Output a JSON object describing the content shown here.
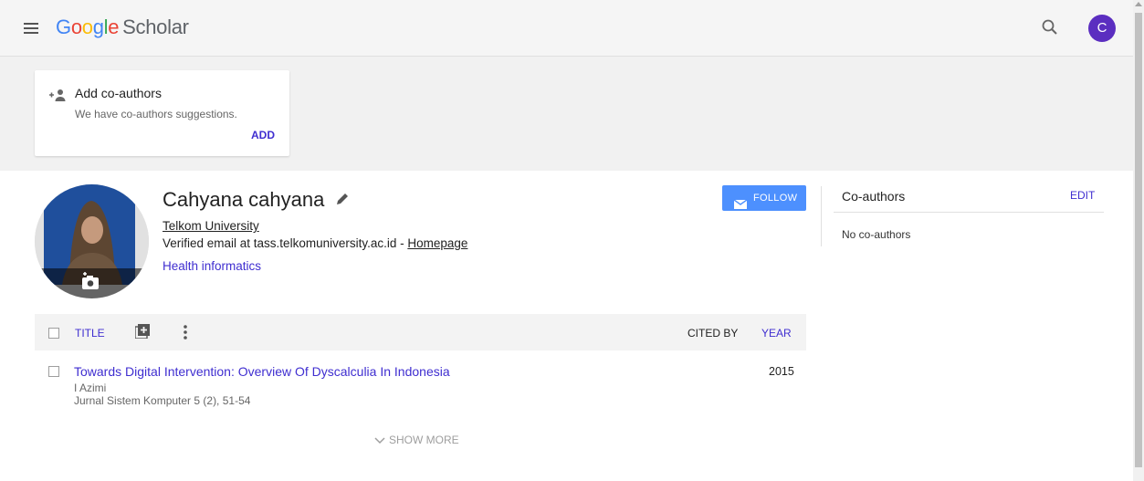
{
  "header": {
    "logo_google": [
      "G",
      "o",
      "o",
      "g",
      "l",
      "e"
    ],
    "logo_scholar": "Scholar",
    "avatar_letter": "C"
  },
  "suggestion_card": {
    "title": "Add co-authors",
    "subtitle": "We have co-authors suggestions.",
    "action": "ADD"
  },
  "profile": {
    "name": "Cahyana cahyana",
    "affiliation": "Telkom University",
    "email_prefix": "Verified email at tass.telkomuniversity.ac.id - ",
    "homepage": "Homepage",
    "interest": "Health informatics",
    "follow_label": "FOLLOW"
  },
  "coauthors": {
    "title": "Co-authors",
    "edit_label": "EDIT",
    "empty_text": "No co-authors"
  },
  "table": {
    "col_title": "TITLE",
    "col_cited_by": "CITED BY",
    "col_year": "YEAR",
    "rows": [
      {
        "title": "Towards Digital Intervention: Overview Of Dyscalculia In Indonesia",
        "authors": "I Azimi",
        "venue": "Jurnal Sistem Komputer 5 (2), 51-54",
        "year": "2015"
      }
    ],
    "show_more": "SHOW MORE"
  },
  "colors": {
    "link": "#3f2ed0",
    "follow_button": "#4d90fe",
    "avatar": "#5b2ec0"
  }
}
